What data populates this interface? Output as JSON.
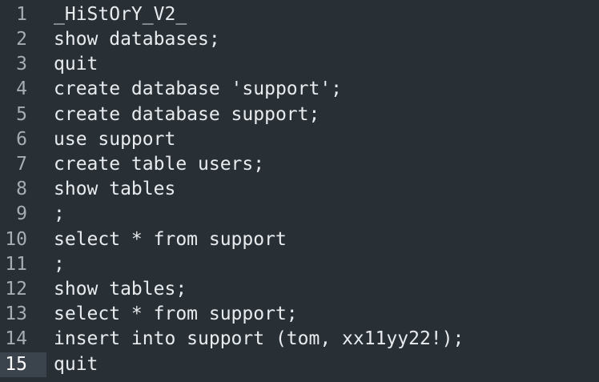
{
  "editor": {
    "current_line": 15,
    "lines": [
      {
        "number": "1",
        "text": "_HiStOrY_V2_"
      },
      {
        "number": "2",
        "text": "show databases;"
      },
      {
        "number": "3",
        "text": "quit"
      },
      {
        "number": "4",
        "text": "create database 'support';"
      },
      {
        "number": "5",
        "text": "create database support;"
      },
      {
        "number": "6",
        "text": "use support"
      },
      {
        "number": "7",
        "text": "create table users;"
      },
      {
        "number": "8",
        "text": "show tables"
      },
      {
        "number": "9",
        "text": ";"
      },
      {
        "number": "10",
        "text": "select * from support"
      },
      {
        "number": "11",
        "text": ";"
      },
      {
        "number": "12",
        "text": "show tables;"
      },
      {
        "number": "13",
        "text": "select * from support;"
      },
      {
        "number": "14",
        "text": "insert into support (tom, xx11yy22!);"
      },
      {
        "number": "15",
        "text": "quit"
      }
    ]
  },
  "colors": {
    "background": "#283036",
    "text": "#e9ecef",
    "line_number": "#a6adb3",
    "current_line_gutter": "#3b444c"
  }
}
